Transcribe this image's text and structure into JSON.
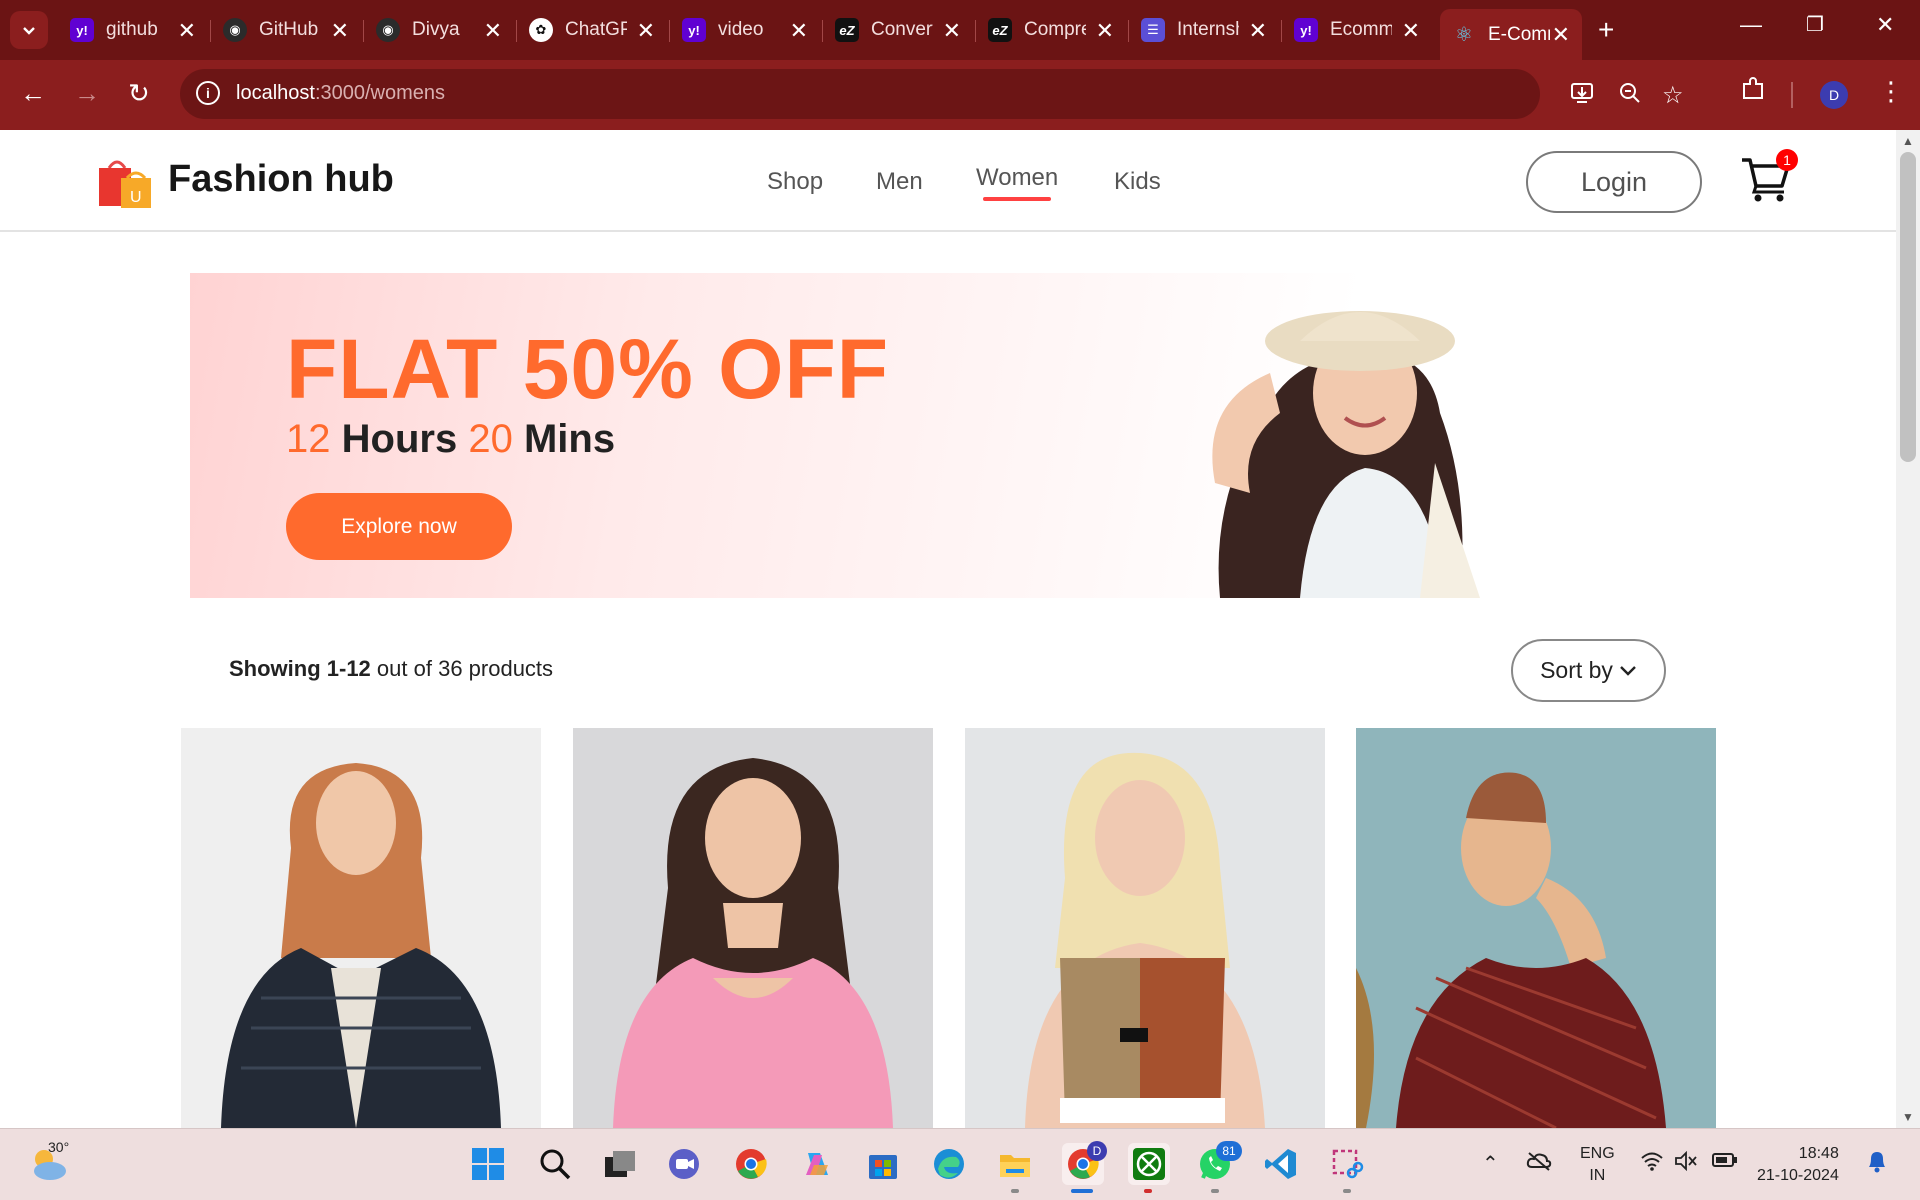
{
  "browser": {
    "tabs": [
      {
        "title": "github",
        "favicon": "yahoo-icon",
        "color": "#6001d2"
      },
      {
        "title": "GitHub",
        "favicon": "github-icon",
        "color": "#222222"
      },
      {
        "title": "Divya",
        "favicon": "github-icon",
        "color": "#222222"
      },
      {
        "title": "ChatGPT",
        "favicon": "chatgpt-icon",
        "color": "#ffffff"
      },
      {
        "title": "video",
        "favicon": "yahoo-icon",
        "color": "#6001d2"
      },
      {
        "title": "Convert",
        "favicon": "ezgif-icon",
        "color": "#111111"
      },
      {
        "title": "Compress",
        "favicon": "ezgif-icon",
        "color": "#111111"
      },
      {
        "title": "Internship",
        "favicon": "list-icon",
        "color": "#5b4fd6"
      },
      {
        "title": "Ecommerce",
        "favicon": "yahoo-icon",
        "color": "#6001d2"
      },
      {
        "title": "E-Commerce",
        "favicon": "react-icon",
        "color": "#61dafb"
      }
    ],
    "address": {
      "host": "localhost",
      "path": ":3000/womens"
    },
    "profile_initial": "D"
  },
  "site": {
    "logo_text": "Fashion hub",
    "nav": {
      "shop": "Shop",
      "men": "Men",
      "women": "Women",
      "kids": "Kids"
    },
    "active_nav": "Women",
    "login_label": "Login",
    "cart_count": "1",
    "accent_color": "#ff6a2d",
    "highlight_color": "#ff4141"
  },
  "hero": {
    "title": "FLAT 50% OFF",
    "hours_value": "12",
    "hours_label": "Hours",
    "mins_value": "20",
    "mins_label": "Mins",
    "cta": "Explore now"
  },
  "listing": {
    "showing_range": "Showing 1-12",
    "showing_rest": "out of 36 products",
    "sort_label": "Sort by"
  },
  "products": [
    {
      "image": "woman-black-fur-jacket"
    },
    {
      "image": "woman-pink-tshirt"
    },
    {
      "image": "woman-brown-sports-top"
    },
    {
      "image": "woman-red-patterned-top"
    }
  ],
  "taskbar": {
    "weather_temp": "30°",
    "lang_line1": "ENG",
    "lang_line2": "IN",
    "time": "18:48",
    "date": "21-10-2024",
    "chrome_badge": "D",
    "whatsapp_badge": "81"
  }
}
